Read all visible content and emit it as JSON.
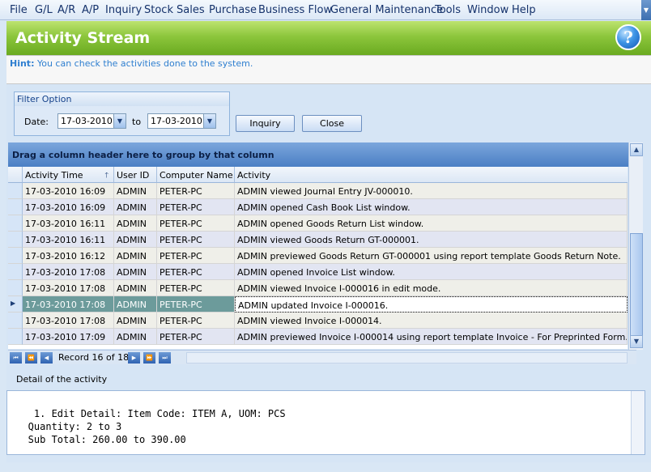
{
  "menu": [
    "File",
    "G/L",
    "A/R",
    "A/P",
    "Inquiry",
    "Stock",
    "Sales",
    "Purchase",
    "Business Flow",
    "General Maintenance",
    "Tools",
    "Window",
    "Help"
  ],
  "banner": {
    "title": "Activity Stream",
    "help_glyph": "?"
  },
  "hint": {
    "label": "Hint:",
    "text": "You can check the activities done to the system."
  },
  "filter": {
    "title": "Filter Option",
    "date_label": "Date:",
    "from": "17-03-2010",
    "to_label": "to",
    "to": "17-03-2010"
  },
  "buttons": {
    "inquiry": "Inquiry",
    "close": "Close"
  },
  "grid": {
    "group_hint": "Drag a column header here to group by that column",
    "columns": [
      "Activity Time",
      "User ID",
      "Computer Name",
      "Activity"
    ],
    "sort_indicator": "🡑",
    "rows": [
      [
        "17-03-2010 16:09",
        "ADMIN",
        "PETER-PC",
        "ADMIN viewed Journal Entry JV-000010."
      ],
      [
        "17-03-2010 16:09",
        "ADMIN",
        "PETER-PC",
        "ADMIN opened Cash Book List window."
      ],
      [
        "17-03-2010 16:11",
        "ADMIN",
        "PETER-PC",
        "ADMIN opened Goods Return List window."
      ],
      [
        "17-03-2010 16:11",
        "ADMIN",
        "PETER-PC",
        "ADMIN viewed Goods Return GT-000001."
      ],
      [
        "17-03-2010 16:12",
        "ADMIN",
        "PETER-PC",
        "ADMIN previewed Goods Return GT-000001 using report template Goods Return Note."
      ],
      [
        "17-03-2010 17:08",
        "ADMIN",
        "PETER-PC",
        "ADMIN opened Invoice List window."
      ],
      [
        "17-03-2010 17:08",
        "ADMIN",
        "PETER-PC",
        "ADMIN viewed Invoice I-000016 in edit mode."
      ],
      [
        "17-03-2010 17:08",
        "ADMIN",
        "PETER-PC",
        "ADMIN updated Invoice I-000016."
      ],
      [
        "17-03-2010 17:08",
        "ADMIN",
        "PETER-PC",
        "ADMIN viewed Invoice I-000014."
      ],
      [
        "17-03-2010 17:09",
        "ADMIN",
        "PETER-PC",
        "ADMIN previewed Invoice I-000014 using report template Invoice - For Preprinted Form."
      ]
    ],
    "selected_row": 7,
    "record_text": "Record 16 of 18"
  },
  "detail": {
    "label": "Detail of the activity",
    "text": "1. Edit Detail: Item Code: ITEM A, UOM: PCS\n   Quantity: 2 to 3\n   Sub Total: 260.00 to 390.00"
  },
  "colors": {
    "banner": "#8cc63c",
    "selected_row": "#6c9b9b",
    "group_bar": "#4b7fc4"
  }
}
